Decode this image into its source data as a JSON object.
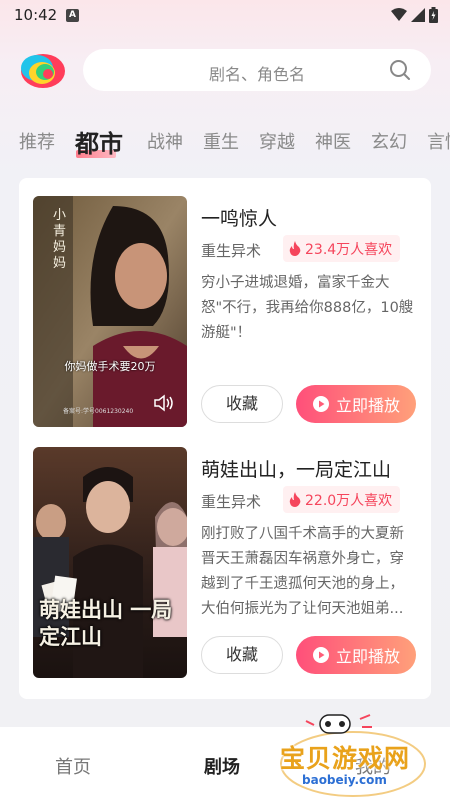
{
  "status_bar": {
    "time": "10:42",
    "notification_icon": "A"
  },
  "search": {
    "placeholder": "剧名、角色名"
  },
  "tabs": [
    {
      "label": "推荐",
      "active": false
    },
    {
      "label": "都市",
      "active": true
    },
    {
      "label": "战神",
      "active": false
    },
    {
      "label": "重生",
      "active": false
    },
    {
      "label": "穿越",
      "active": false
    },
    {
      "label": "神医",
      "active": false
    },
    {
      "label": "玄幻",
      "active": false
    },
    {
      "label": "言情",
      "active": false
    }
  ],
  "dramas": [
    {
      "title": "一鸣惊人",
      "genre": "重生异术",
      "likes": "23.4万人喜欢",
      "description": "穷小子进城退婚，富家千金大怒\"不行，我再给你888亿，10艘游艇\"！",
      "poster_caption": "你妈做手术要20万",
      "poster_vertical_text": "小青妈妈",
      "poster_small_text": "备案号:学号0061230240",
      "favorite_label": "收藏",
      "play_label": "立即播放"
    },
    {
      "title": "萌娃出山，一局定江山",
      "genre": "重生异术",
      "likes": "22.0万人喜欢",
      "description": "刚打败了八国千术高手的大夏新晋天王萧磊因车祸意外身亡，穿越到了千王遗孤何天池的身上，大伯何振光为了让何天池姐弟...",
      "poster_title": "萌娃出山 一局定江山",
      "favorite_label": "收藏",
      "play_label": "立即播放"
    }
  ],
  "bottom_nav": [
    {
      "label": "首页",
      "active": false
    },
    {
      "label": "剧场",
      "active": true
    },
    {
      "label": "我的",
      "active": false
    }
  ],
  "watermark": {
    "text": "宝贝游戏网",
    "url": "baobeiy.com"
  },
  "colors": {
    "accent": "#f5455c",
    "play_gradient_start": "#ff4f7a",
    "play_gradient_end": "#ffa07a",
    "watermark": "#e9a21b"
  }
}
